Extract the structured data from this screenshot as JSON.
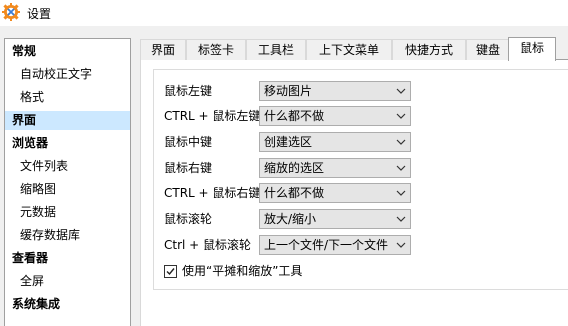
{
  "window": {
    "title": "设置",
    "icon": "xnview-gear-icon"
  },
  "sidebar": {
    "items": [
      {
        "label": "常规",
        "kind": "category"
      },
      {
        "label": "自动校正文字",
        "kind": "sub"
      },
      {
        "label": "格式",
        "kind": "sub"
      },
      {
        "label": "界面",
        "kind": "category",
        "selected": true
      },
      {
        "label": "浏览器",
        "kind": "category"
      },
      {
        "label": "文件列表",
        "kind": "sub"
      },
      {
        "label": "缩略图",
        "kind": "sub"
      },
      {
        "label": "元数据",
        "kind": "sub"
      },
      {
        "label": "缓存数据库",
        "kind": "sub"
      },
      {
        "label": "查看器",
        "kind": "category"
      },
      {
        "label": "全屏",
        "kind": "sub"
      },
      {
        "label": "系统集成",
        "kind": "category"
      }
    ]
  },
  "tabs": [
    {
      "label": "界面"
    },
    {
      "label": "标签卡"
    },
    {
      "label": "工具栏"
    },
    {
      "label": "上下文菜单"
    },
    {
      "label": "快捷方式"
    },
    {
      "label": "键盘"
    },
    {
      "label": "鼠标",
      "active": true
    }
  ],
  "mouse": {
    "rows": [
      {
        "label": "鼠标左键",
        "value": "移动图片"
      },
      {
        "label": "CTRL + 鼠标左键",
        "value": "什么都不做"
      },
      {
        "label": "鼠标中键",
        "value": "创建选区"
      },
      {
        "label": "鼠标右键",
        "value": "缩放的选区"
      },
      {
        "label": "CTRL + 鼠标右键",
        "value": "什么都不做"
      },
      {
        "label": "鼠标滚轮",
        "value": "放大/缩小"
      },
      {
        "label": "Ctrl + 鼠标滚轮",
        "value": "上一个文件/下一个文件"
      }
    ],
    "pan_zoom_tool": {
      "label": "使用“平摊和缩放”工具",
      "checked": true
    }
  },
  "colors": {
    "selection": "#cce8ff",
    "combo_bg": "#e5e5e5",
    "border": "#a0a0a0"
  }
}
